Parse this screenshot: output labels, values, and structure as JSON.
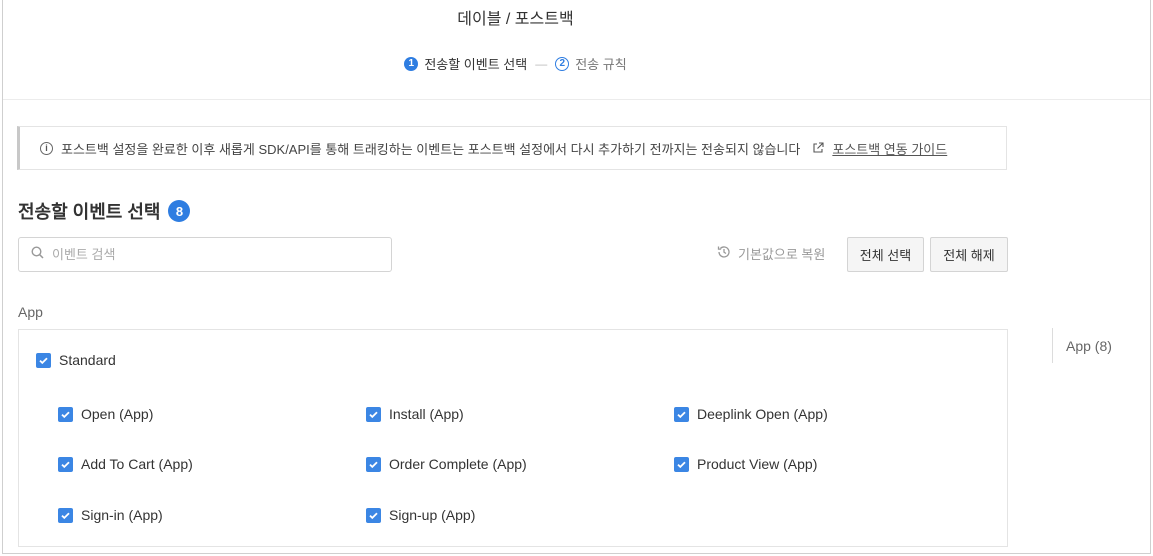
{
  "header": {
    "breadcrumb": "데이블 / 포스트백",
    "steps": [
      {
        "num": "1",
        "label": "전송할 이벤트 선택",
        "active": true
      },
      {
        "num": "2",
        "label": "전송 규칙",
        "active": false
      }
    ],
    "step_separator": "—"
  },
  "notice": {
    "info_glyph": "i",
    "text": "포스트백 설정을 완료한 이후 새롭게 SDK/API를 통해 트래킹하는 이벤트는 포스트백 설정에서 다시 추가하기 전까지는 전송되지 않습니다",
    "link_label": "포스트백 연동 가이드"
  },
  "section": {
    "title": "전송할 이벤트 선택",
    "count": "8"
  },
  "search": {
    "placeholder": "이벤트 검색",
    "value": ""
  },
  "toolbar": {
    "reset_label": "기본값으로 복원",
    "select_all_label": "전체 선택",
    "deselect_all_label": "전체 해제"
  },
  "group": {
    "label": "App",
    "parent": {
      "label": "Standard",
      "checked": true
    },
    "events": [
      {
        "label": "Open (App)",
        "checked": true
      },
      {
        "label": "Install (App)",
        "checked": true
      },
      {
        "label": "Deeplink Open (App)",
        "checked": true
      },
      {
        "label": "Add To Cart (App)",
        "checked": true
      },
      {
        "label": "Order Complete (App)",
        "checked": true
      },
      {
        "label": "Product View (App)",
        "checked": true
      },
      {
        "label": "Sign-in (App)",
        "checked": true
      },
      {
        "label": "Sign-up (App)",
        "checked": true
      }
    ]
  },
  "side_nav": {
    "items": [
      {
        "label": "App (8)"
      }
    ]
  },
  "colors": {
    "accent": "#2e7de1",
    "checkbox": "#3b86e4"
  }
}
